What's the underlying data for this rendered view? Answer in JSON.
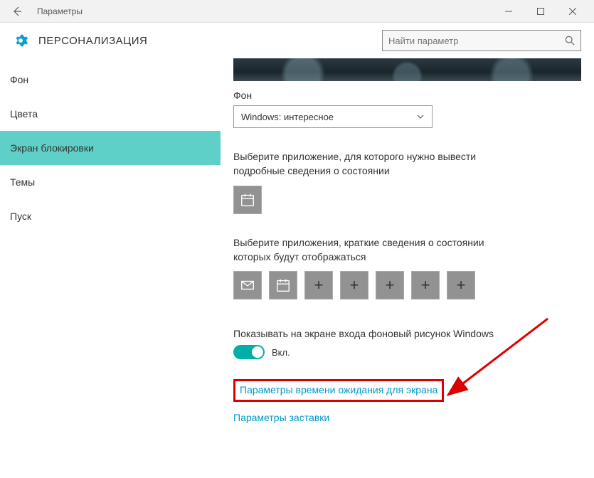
{
  "window": {
    "title": "Параметры"
  },
  "header": {
    "heading": "ПЕРСОНАЛИЗАЦИЯ",
    "search_placeholder": "Найти параметр"
  },
  "sidebar": {
    "items": [
      {
        "label": "Фон",
        "active": false
      },
      {
        "label": "Цвета",
        "active": false
      },
      {
        "label": "Экран блокировки",
        "active": true
      },
      {
        "label": "Темы",
        "active": false
      },
      {
        "label": "Пуск",
        "active": false
      }
    ]
  },
  "content": {
    "background_label": "Фон",
    "background_selected": "Windows: интересное",
    "detailed_app_label": "Выберите приложение, для которого нужно вывести подробные сведения о состоянии",
    "quick_apps_label": "Выберите приложения, краткие сведения о состоянии которых будут отображаться",
    "show_bg_label": "Показывать на экране входа фоновый рисунок Windows",
    "toggle_state": "Вкл.",
    "link_timeout": "Параметры времени ожидания для экрана",
    "link_screensaver": "Параметры заставки"
  },
  "icons": {
    "plus": "+",
    "calendar": "calendar",
    "mail": "mail"
  }
}
